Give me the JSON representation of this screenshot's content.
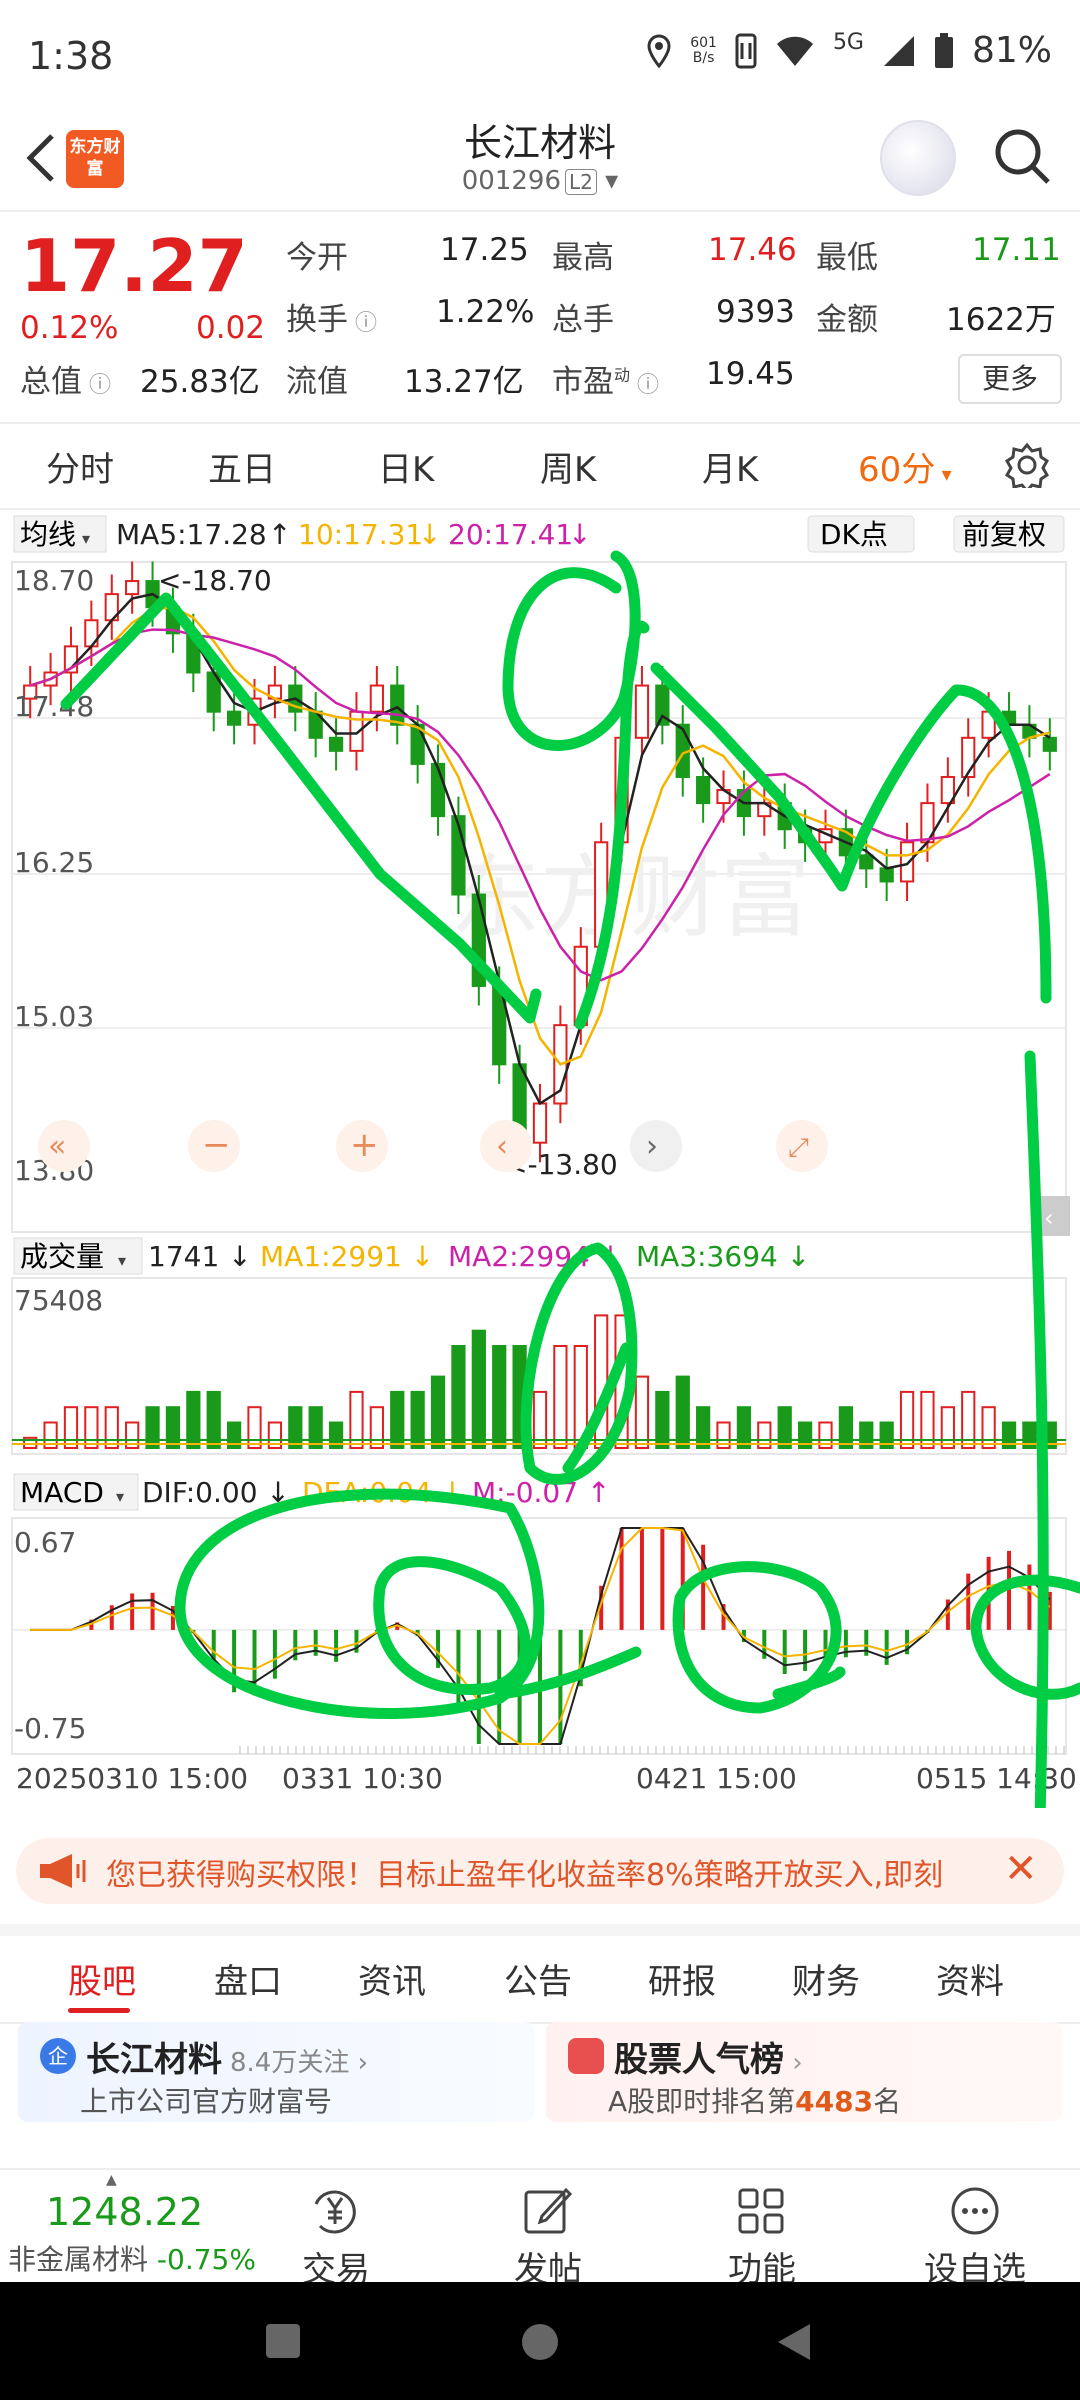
{
  "status_bar": {
    "time": "1:38",
    "net_speed_value": "601",
    "net_speed_unit": "B/s",
    "network": "5G",
    "battery": "81%"
  },
  "header": {
    "logo_text": "东方财富",
    "title": "长江材料",
    "code": "001296",
    "level": "L2"
  },
  "quote": {
    "price": "17.27",
    "change_pct": "0.12%",
    "change": "0.02",
    "open_label": "今开",
    "open": "17.25",
    "high_label": "最高",
    "high": "17.46",
    "low_label": "最低",
    "low": "17.11",
    "turnover_label": "换手",
    "turnover": "1.22%",
    "volume_label": "总手",
    "volume": "9393",
    "amount_label": "金额",
    "amount": "1622万",
    "mcap_label": "总值",
    "mcap": "25.83亿",
    "float_label": "流值",
    "float": "13.27亿",
    "pe_label": "市盈",
    "pe_sup": "动",
    "pe": "19.45",
    "more": "更多"
  },
  "tabs": [
    "分时",
    "五日",
    "日K",
    "周K",
    "月K",
    "60分"
  ],
  "chart": {
    "ma_selector": "均线",
    "ma5": "MA5:17.28",
    "ma10": "10:17.31",
    "ma20": "20:17.41",
    "dk_label": "DK点",
    "adjust_label": "前复权",
    "y_labels": [
      "18.70",
      "17.48",
      "16.25",
      "15.03",
      "13.80"
    ],
    "high_marker": "18.70",
    "low_marker": "<-13.80",
    "vol_selector": "成交量",
    "vol_value": "1741",
    "vol_ma1": "MA1:2991",
    "vol_ma2": "MA2:2994",
    "vol_ma3": "MA3:3694",
    "vol_max": "75408",
    "macd_selector": "MACD",
    "dif": "DIF:0.00",
    "dea": "DEA:0.04",
    "m": "M:-0.07",
    "macd_max": "0.67",
    "macd_min": "-0.75",
    "dates": [
      "20250310 15:00",
      "0331 10:30",
      "0421 15:00",
      "0515 14:30"
    ],
    "colors": {
      "up": "#e02020",
      "down": "#1a9a1a",
      "ma5": "#222222",
      "ma10": "#f5b400",
      "ma20": "#cc22aa",
      "ma3": "#1a9a1a",
      "annotation": "#00cc44"
    }
  },
  "chart_data": {
    "type": "candlestick",
    "ylim": [
      13.8,
      18.7
    ],
    "close": [
      17.8,
      17.9,
      18.1,
      18.3,
      18.5,
      18.6,
      18.4,
      18.2,
      17.9,
      17.6,
      17.5,
      17.7,
      17.8,
      17.6,
      17.4,
      17.3,
      17.6,
      17.8,
      17.5,
      17.2,
      16.8,
      16.2,
      15.5,
      14.9,
      14.3,
      14.6,
      15.2,
      15.8,
      16.6,
      17.4,
      17.8,
      17.5,
      17.1,
      16.9,
      17.0,
      16.8,
      16.9,
      16.7,
      16.6,
      16.7,
      16.5,
      16.4,
      16.3,
      16.6,
      16.9,
      17.1,
      17.4,
      17.6,
      17.5,
      17.4,
      17.3
    ],
    "volume_max": 75408,
    "macd_range": [
      -0.75,
      0.67
    ]
  },
  "notice": {
    "text": "您已获得购买权限！目标止盈年化收益率8%策略开放买入,即刻"
  },
  "bottom_tabs": [
    "股吧",
    "盘口",
    "资讯",
    "公告",
    "研报",
    "财务",
    "资料"
  ],
  "cards": {
    "c1_badge": "企",
    "c1_title": "长江材料",
    "c1_follow": "8.4万关注",
    "c1_sub": "上市公司官方财富号",
    "c2_title": "股票人气榜",
    "c2_sub_prefix": "A股即时排名第",
    "c2_rank": "4483",
    "c2_sub_suffix": "名"
  },
  "footer": {
    "index_value": "1248.22",
    "index_name": "非金属材料",
    "index_change": "-0.75%",
    "items": [
      "交易",
      "发帖",
      "功能",
      "设自选"
    ]
  }
}
